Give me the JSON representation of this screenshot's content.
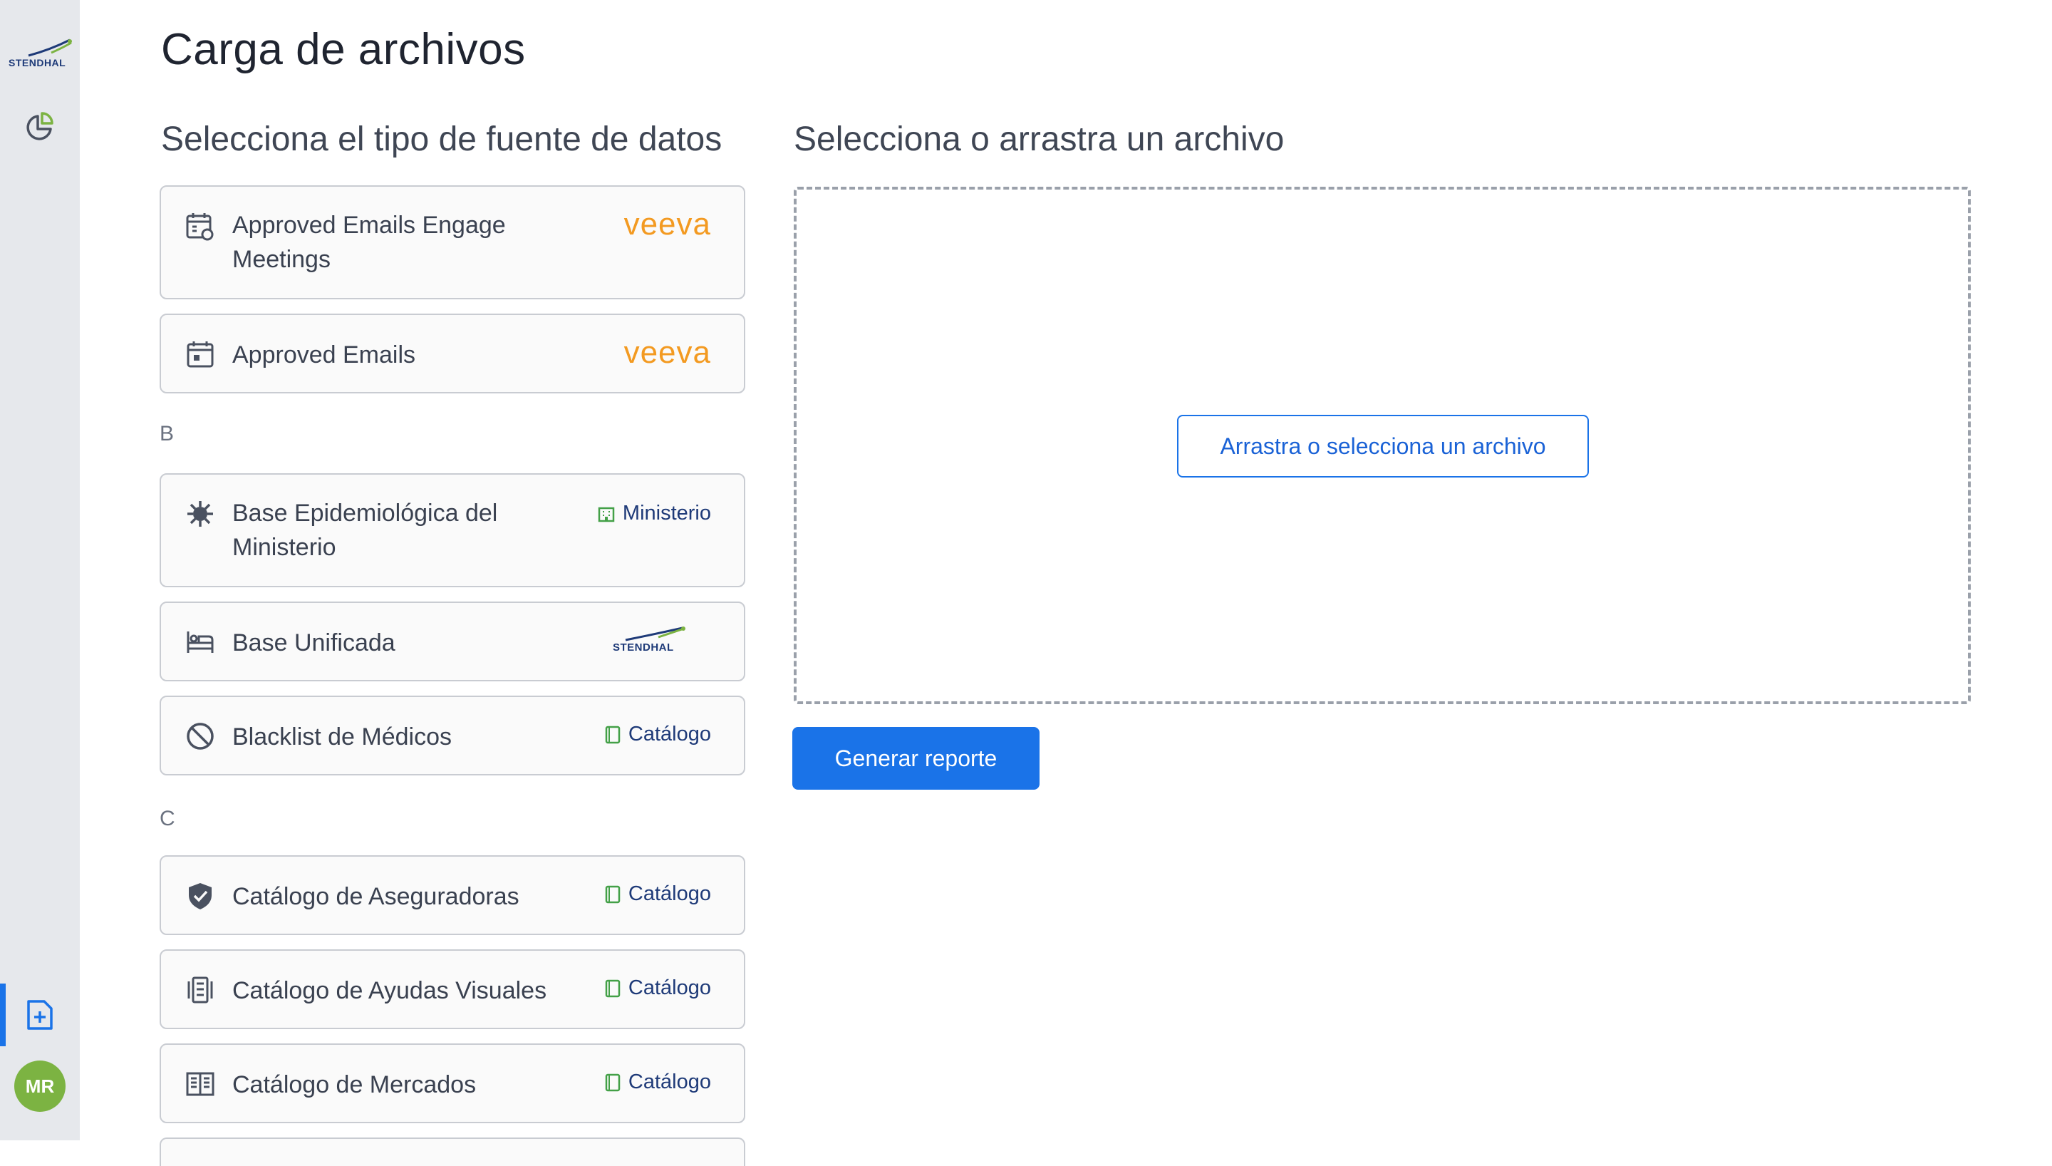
{
  "sidebar": {
    "logo_text": "STENDHAL",
    "icons": [
      "analytics-icon",
      "file-upload-icon"
    ],
    "avatar_initials": "MR"
  },
  "page": {
    "title": "Carga de archivos",
    "left_heading": "Selecciona el tipo de fuente de datos",
    "right_heading": "Selecciona o arrastra un archivo"
  },
  "groups": {
    "B": "B",
    "C": "C"
  },
  "sources": [
    {
      "label": "Approved Emails Engage Meetings",
      "icon": "calendar-meeting-icon",
      "source": "Veeva"
    },
    {
      "label": "Approved Emails",
      "icon": "calendar-icon",
      "source": "Veeva"
    },
    {
      "label": "Base Epidemiológica del Ministerio",
      "icon": "virus-icon",
      "source": "Ministerio"
    },
    {
      "label": "Base Unificada",
      "icon": "bed-icon",
      "source": "STENDHAL"
    },
    {
      "label": "Blacklist de Médicos",
      "icon": "block-icon",
      "source": "Catálogo"
    },
    {
      "label": "Catálogo de Aseguradoras",
      "icon": "shield-check-icon",
      "source": "Catálogo"
    },
    {
      "label": "Catálogo de Ayudas Visuales",
      "icon": "gallery-icon",
      "source": "Catálogo"
    },
    {
      "label": "Catálogo de Mercados",
      "icon": "book-icon",
      "source": "Catálogo"
    }
  ],
  "upload": {
    "select_button": "Arrastra o selecciona un archivo",
    "generate_button": "Generar reporte"
  },
  "colors": {
    "primary": "#1a73e8",
    "veeva": "#f39a21",
    "catalog": "#43a047",
    "navy": "#1e3a78",
    "avatar": "#7cb342"
  }
}
